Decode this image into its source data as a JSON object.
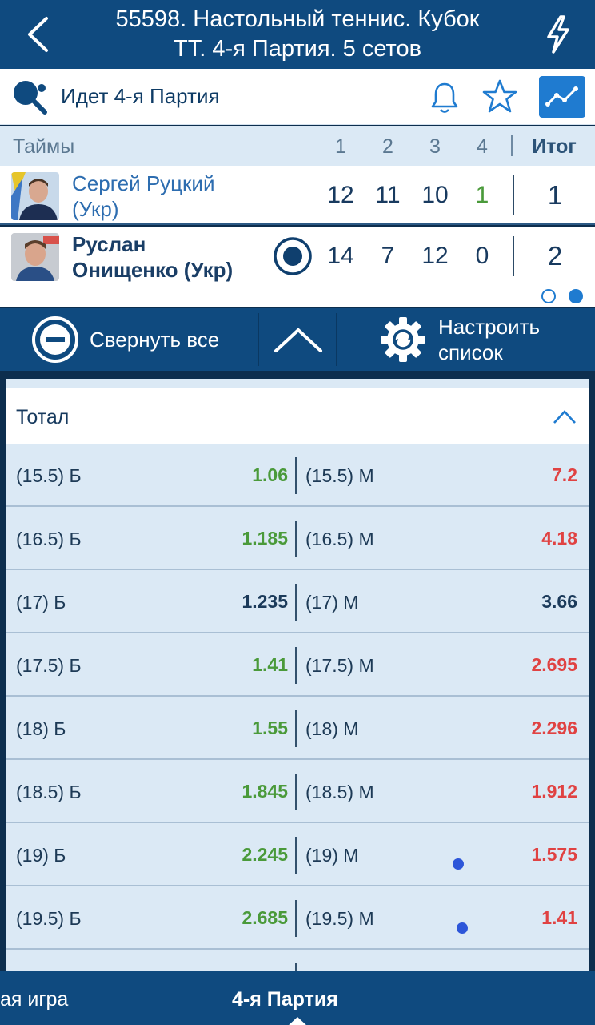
{
  "header": {
    "title_line1": "55598. Настольный теннис. Кубок",
    "title_line2": "ТТ. 4-я  Партия. 5 сетов"
  },
  "status": {
    "text": "Идет 4-я  Партия"
  },
  "score": {
    "label": "Таймы",
    "sets": [
      "1",
      "2",
      "3",
      "4"
    ],
    "total_label": "Итог",
    "players": [
      {
        "name_line1": "Сергей Руцкий",
        "name_line2": "(Укр)",
        "scores": [
          "12",
          "11",
          "10",
          "1"
        ],
        "total": "1"
      },
      {
        "name_line1": "Руслан",
        "name_line2": "Онищенко (Укр)",
        "scores": [
          "14",
          "7",
          "12",
          "0"
        ],
        "total": "2"
      }
    ]
  },
  "toolbar": {
    "collapse_label": "Свернуть все",
    "config_line1": "Настроить",
    "config_line2": "список"
  },
  "market": {
    "title": "Тотал",
    "rows": [
      {
        "left_label": "(15.5) Б",
        "left_value": "1.06",
        "right_label": "(15.5) М",
        "right_value": "7.2"
      },
      {
        "left_label": "(16.5) Б",
        "left_value": "1.185",
        "right_label": "(16.5) М",
        "right_value": "4.18"
      },
      {
        "left_label": "(17) Б",
        "left_value": "1.235",
        "right_label": "(17) М",
        "right_value": "3.66"
      },
      {
        "left_label": "(17.5) Б",
        "left_value": "1.41",
        "right_label": "(17.5) М",
        "right_value": "2.695"
      },
      {
        "left_label": "(18) Б",
        "left_value": "1.55",
        "right_label": "(18) М",
        "right_value": "2.296"
      },
      {
        "left_label": "(18.5) Б",
        "left_value": "1.845",
        "right_label": "(18.5) М",
        "right_value": "1.912"
      },
      {
        "left_label": "(19) Б",
        "left_value": "2.245",
        "right_label": "(19) М",
        "right_value": "1.575"
      },
      {
        "left_label": "(19.5) Б",
        "left_value": "2.685",
        "right_label": "(19.5) М",
        "right_value": "1.41"
      }
    ]
  },
  "tabs": {
    "prev": "ая игра",
    "current": "4-я  Партия"
  },
  "colors": {
    "header_bg": "#0f4a7f",
    "accent": "#1f7bd0",
    "up_odds": "#4a9a3a",
    "down_odds": "#e04242"
  }
}
